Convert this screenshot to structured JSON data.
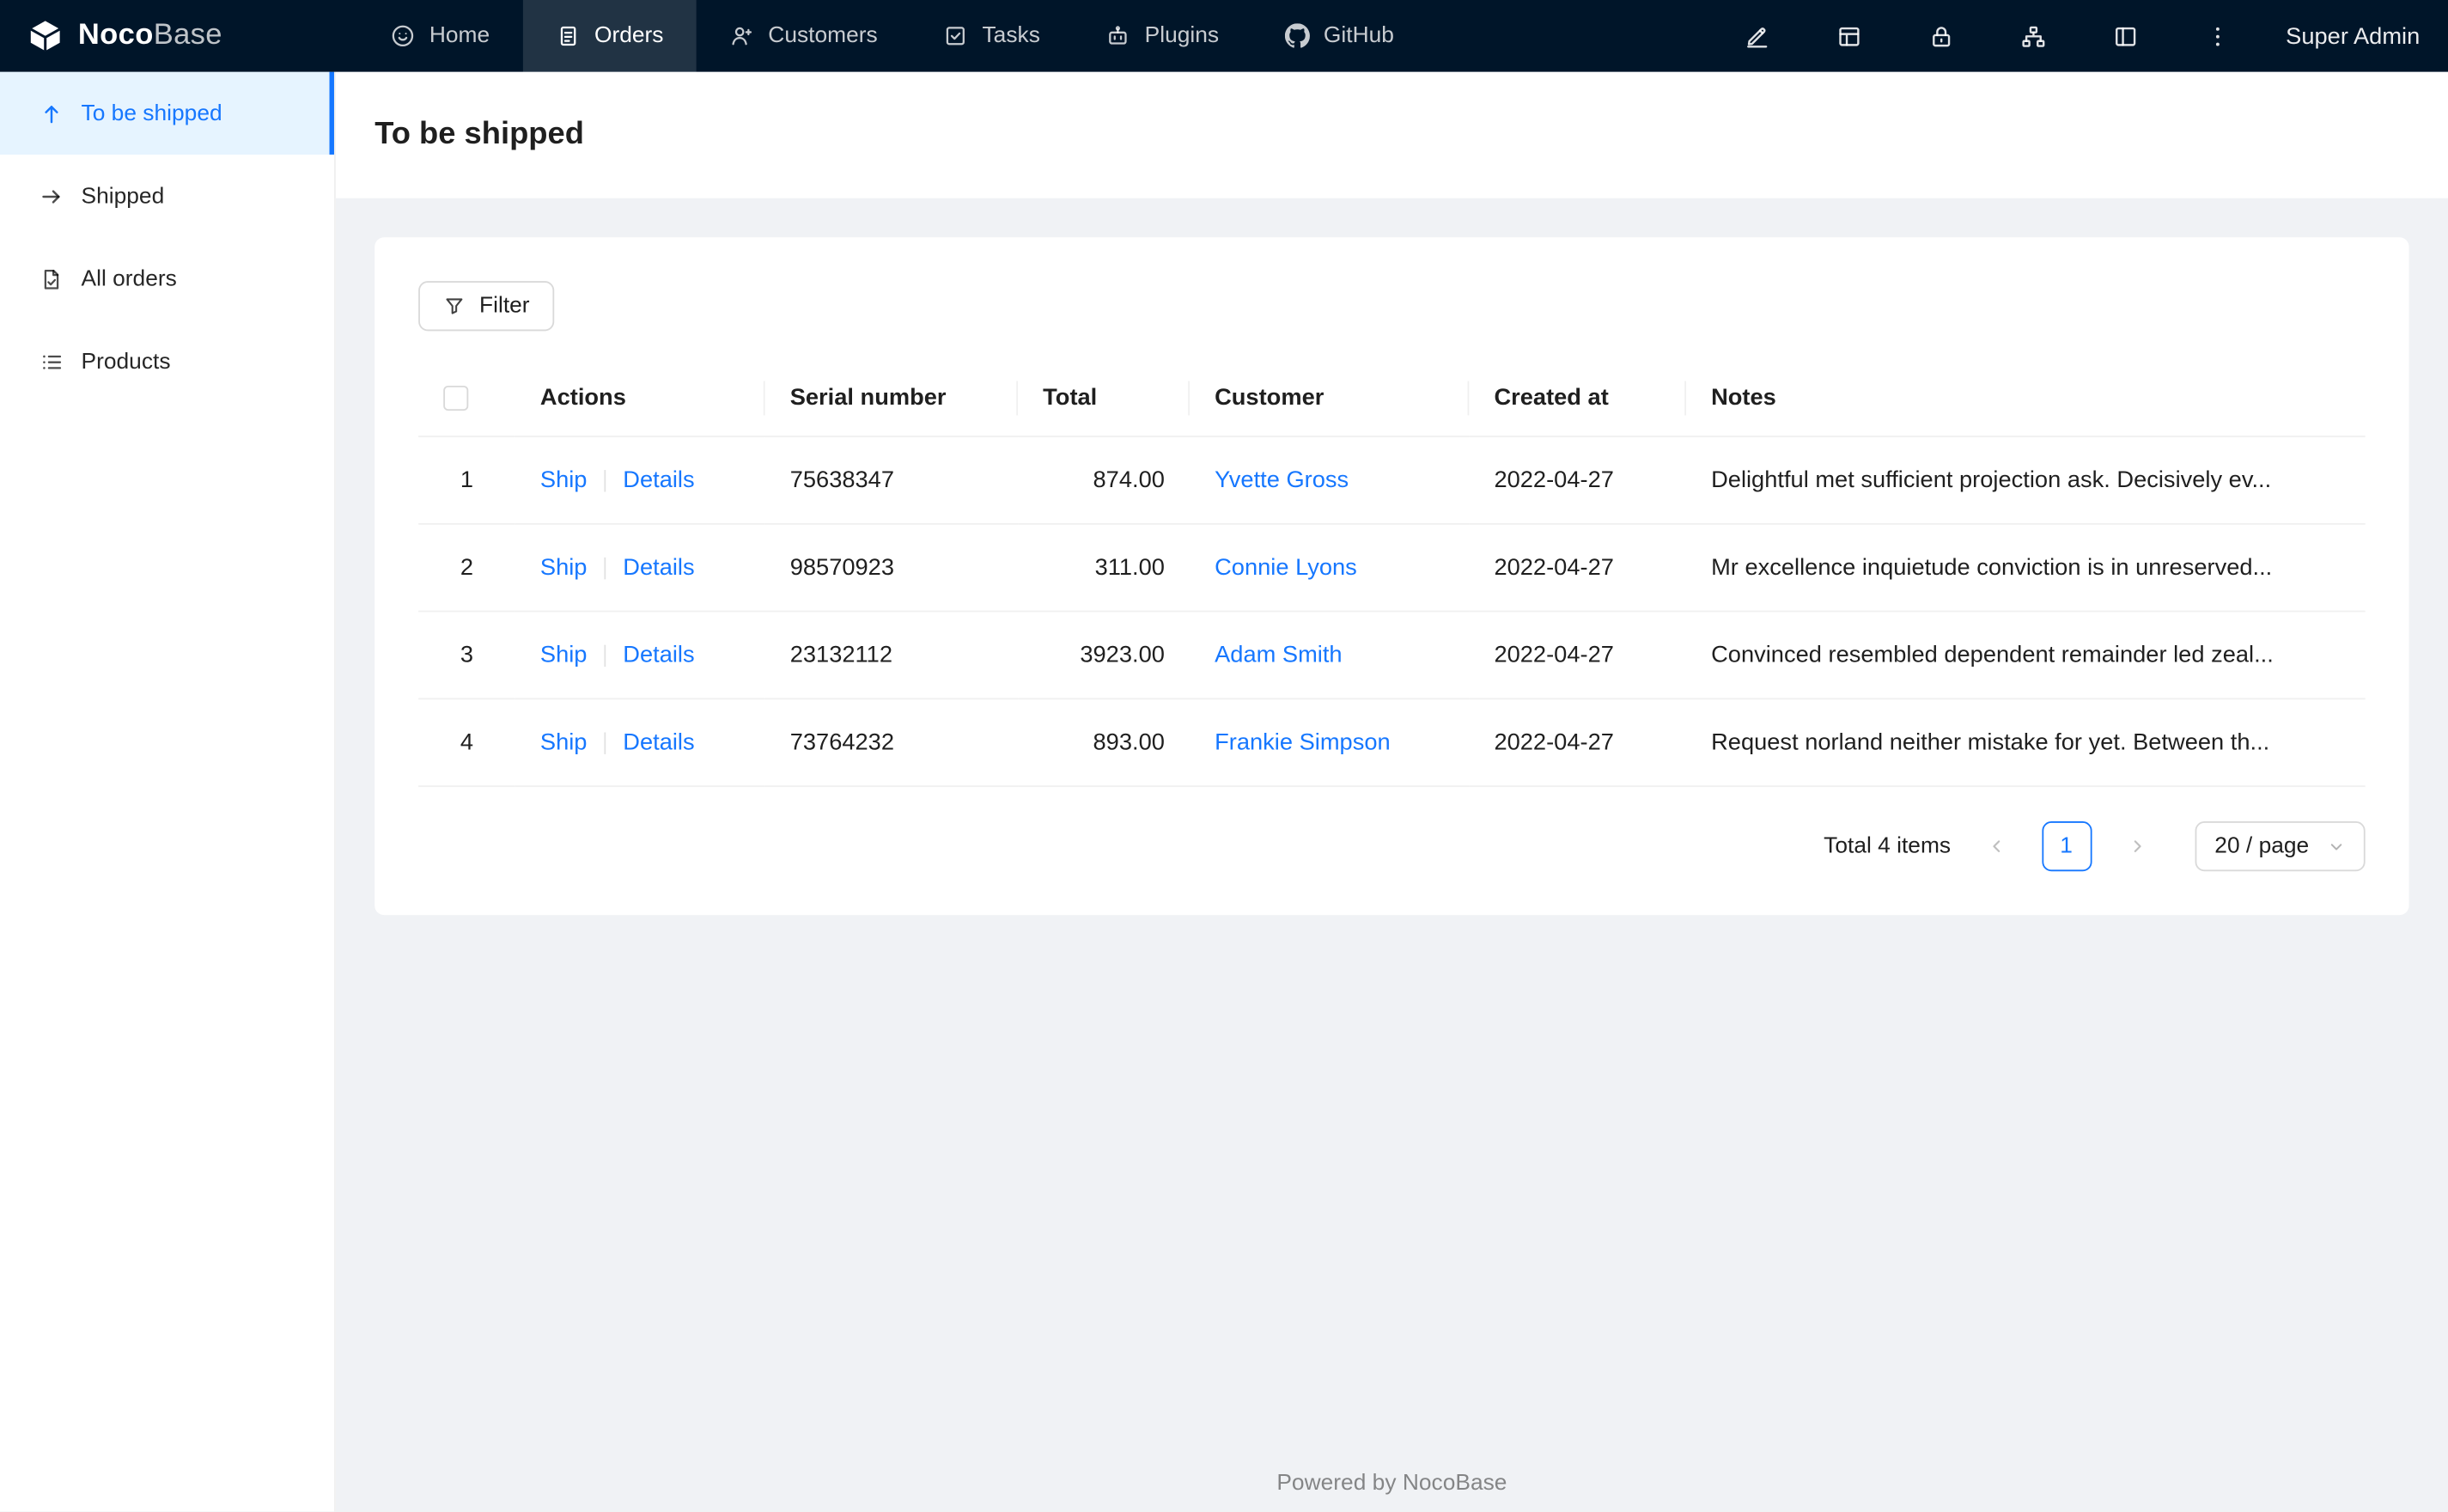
{
  "topbar": {
    "logo_primary": "Noco",
    "logo_secondary": "Base",
    "nav": [
      {
        "label": "Home"
      },
      {
        "label": "Orders"
      },
      {
        "label": "Customers"
      },
      {
        "label": "Tasks"
      },
      {
        "label": "Plugins"
      },
      {
        "label": "GitHub"
      }
    ],
    "user": "Super Admin"
  },
  "sidebar": {
    "items": [
      {
        "label": "To be shipped"
      },
      {
        "label": "Shipped"
      },
      {
        "label": "All orders"
      },
      {
        "label": "Products"
      }
    ]
  },
  "page": {
    "title": "To be shipped"
  },
  "toolbar": {
    "filter_label": "Filter"
  },
  "table": {
    "columns": {
      "actions": "Actions",
      "serial": "Serial number",
      "total": "Total",
      "customer": "Customer",
      "created": "Created at",
      "notes": "Notes"
    },
    "action_labels": {
      "ship": "Ship",
      "details": "Details"
    },
    "rows": [
      {
        "index": "1",
        "serial": "75638347",
        "total": "874.00",
        "customer": "Yvette Gross",
        "created": "2022-04-27",
        "notes": "Delightful met sufficient projection ask. Decisively ev..."
      },
      {
        "index": "2",
        "serial": "98570923",
        "total": "311.00",
        "customer": "Connie Lyons",
        "created": "2022-04-27",
        "notes": "Mr excellence inquietude conviction is in unreserved..."
      },
      {
        "index": "3",
        "serial": "23132112",
        "total": "3923.00",
        "customer": "Adam Smith",
        "created": "2022-04-27",
        "notes": "Convinced resembled dependent remainder led zeal..."
      },
      {
        "index": "4",
        "serial": "73764232",
        "total": "893.00",
        "customer": "Frankie Simpson",
        "created": "2022-04-27",
        "notes": "Request norland neither mistake for yet. Between th..."
      }
    ]
  },
  "pagination": {
    "total_text": "Total 4 items",
    "current_page": "1",
    "page_size": "20 / page"
  },
  "footer": {
    "text": "Powered by NocoBase"
  },
  "colors": {
    "accent": "#1677ff",
    "topbar_bg": "#001529",
    "sidebar_active_bg": "#e6f4ff",
    "layout_bg": "#f0f2f5"
  }
}
